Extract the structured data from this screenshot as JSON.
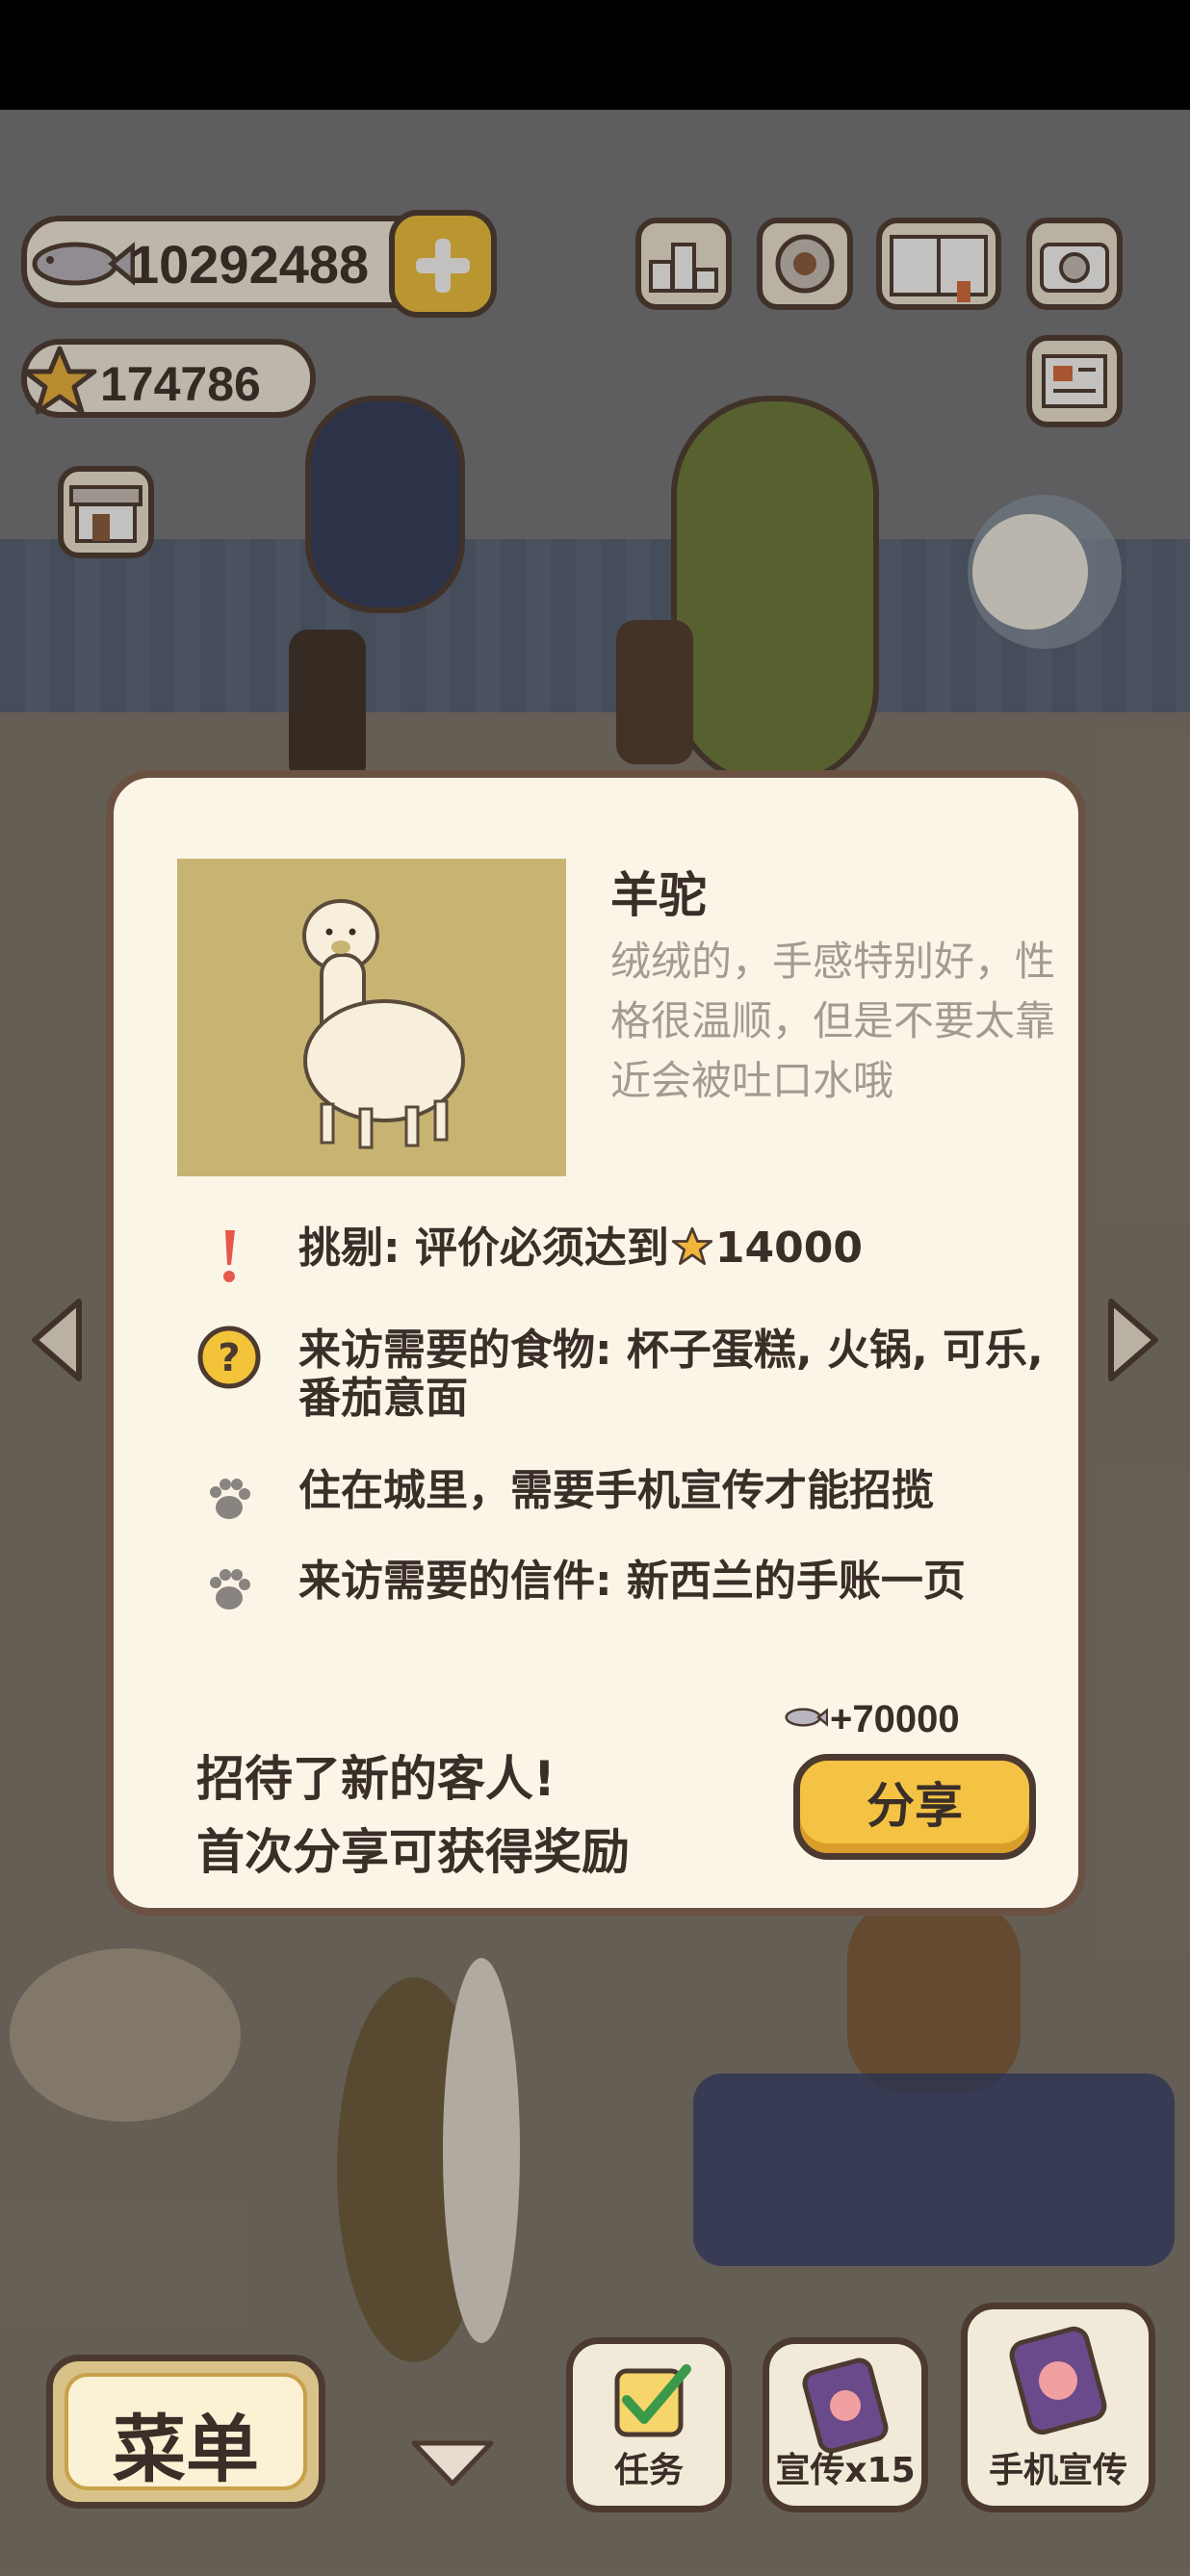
{
  "currency": {
    "fish": "10292488",
    "stars": "174786"
  },
  "modal": {
    "animal_name": "羊驼",
    "description": "绒绒的，手感特别好，性格很温顺，但是不要太靠近会被吐口水哦",
    "requirements": [
      {
        "icon": "exclamation-icon",
        "text_before": "挑剔: 评价必须达到",
        "star_value": "14000"
      },
      {
        "icon": "question-icon",
        "text": "来访需要的食物: 杯子蛋糕, 火锅, 可乐, 番茄意面"
      },
      {
        "icon": "paw-icon",
        "text": "住在城里，需要手机宣传才能招揽"
      },
      {
        "icon": "paw-icon",
        "text": "来访需要的信件: 新西兰的手账一页"
      }
    ],
    "reward": "+70000",
    "promo_line1": "招待了新的客人!",
    "promo_line2": "首次分享可获得奖励",
    "share_label": "分享"
  },
  "bottom_bar": {
    "menu_label": "菜单",
    "tasks_label": "任务",
    "promo_label": "宣传x15",
    "phone_promo_label": "手机宣传"
  },
  "colors": {
    "accent": "#f4c344",
    "outline": "#4c3a30",
    "panel": "#fbf5e8",
    "portrait_bg": "#c8b472"
  }
}
